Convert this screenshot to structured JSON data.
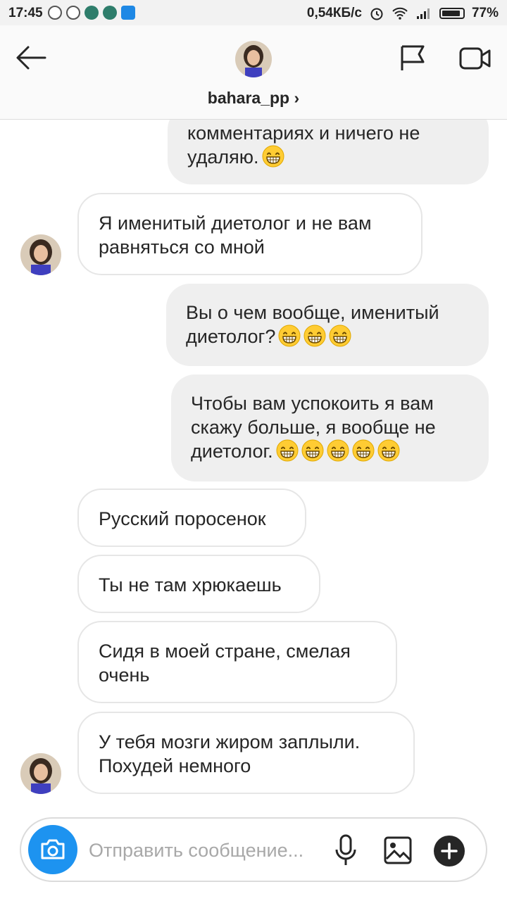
{
  "status_bar": {
    "time": "17:45",
    "speed": "0,54КБ/с",
    "battery": "77%",
    "battery_level": 0.77
  },
  "header": {
    "back_icon": "arrow-left-icon",
    "username": "bahara_pp",
    "chevron": "›",
    "flag_icon": "flag-icon",
    "video_icon": "video-camera-icon"
  },
  "messages": [
    {
      "side": "out",
      "text": "комментариях и ничего не удаляю.",
      "emoji_count": 1
    },
    {
      "side": "in",
      "text": "Я именитый диетолог и не вам равняться со мной",
      "emoji_count": 0
    },
    {
      "side": "out",
      "text": "Вы о чем вообще, именитый диетолог?",
      "emoji_count": 3
    },
    {
      "side": "out",
      "text": "Чтобы вам успокоить я вам скажу больше, я вообще не диетолог.",
      "emoji_count": 5
    },
    {
      "side": "in",
      "text": "Русский поросенок",
      "emoji_count": 0
    },
    {
      "side": "in",
      "text": "Ты не там хрюкаешь",
      "emoji_count": 0
    },
    {
      "side": "in",
      "text": "Сидя в моей стране, смелая очень",
      "emoji_count": 0
    },
    {
      "side": "in",
      "text": "У тебя мозги жиром заплыли. Похудей немного",
      "emoji_count": 0
    }
  ],
  "composer": {
    "placeholder": "Отправить сообщение...",
    "camera_icon": "camera-icon",
    "mic_icon": "microphone-icon",
    "gallery_icon": "image-icon",
    "plus_icon": "plus-icon"
  },
  "colors": {
    "accent": "#1d93f0",
    "outgoing_bubble": "#efefef",
    "incoming_border": "#e6e6e6"
  }
}
